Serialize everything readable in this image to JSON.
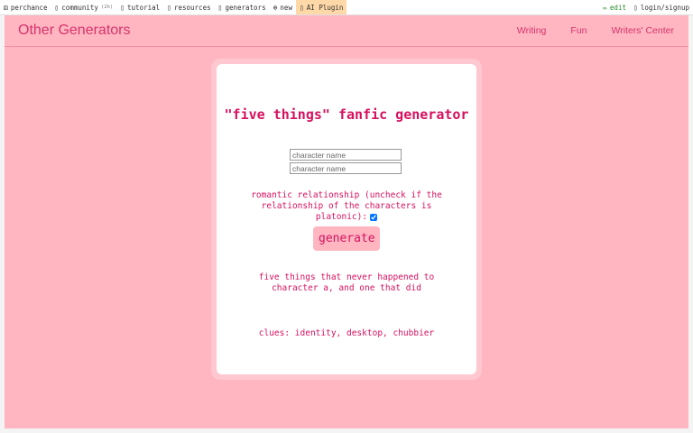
{
  "topbar": {
    "items": [
      {
        "icon": "⚄",
        "label": "perchance"
      },
      {
        "icon": "▯",
        "label": "community",
        "extra": "(2h)"
      },
      {
        "icon": "▯",
        "label": "tutorial"
      },
      {
        "icon": "▯",
        "label": "resources"
      },
      {
        "icon": "▯",
        "label": "generators"
      },
      {
        "icon": "⊕",
        "label": "new"
      },
      {
        "icon": "▯",
        "label": "AI Plugin"
      }
    ],
    "edit": {
      "icon": "✏",
      "label": "edit"
    },
    "login": {
      "icon": "▯",
      "label": "login/signup"
    }
  },
  "navbar": {
    "brand": "Other Generators",
    "links": [
      "Writing",
      "Fun",
      "Writers' Center"
    ]
  },
  "main": {
    "title": "\"five things\" fanfic generator",
    "input1_placeholder": "character name",
    "input2_placeholder": "character name",
    "romantic_label": "romantic relationship (uncheck if the relationship of the characters is platonic):",
    "romantic_checked": true,
    "generate_label": "generate",
    "result": "five things that never happened to character a, and one that did",
    "clues": "clues: identity, desktop, chubbier"
  }
}
